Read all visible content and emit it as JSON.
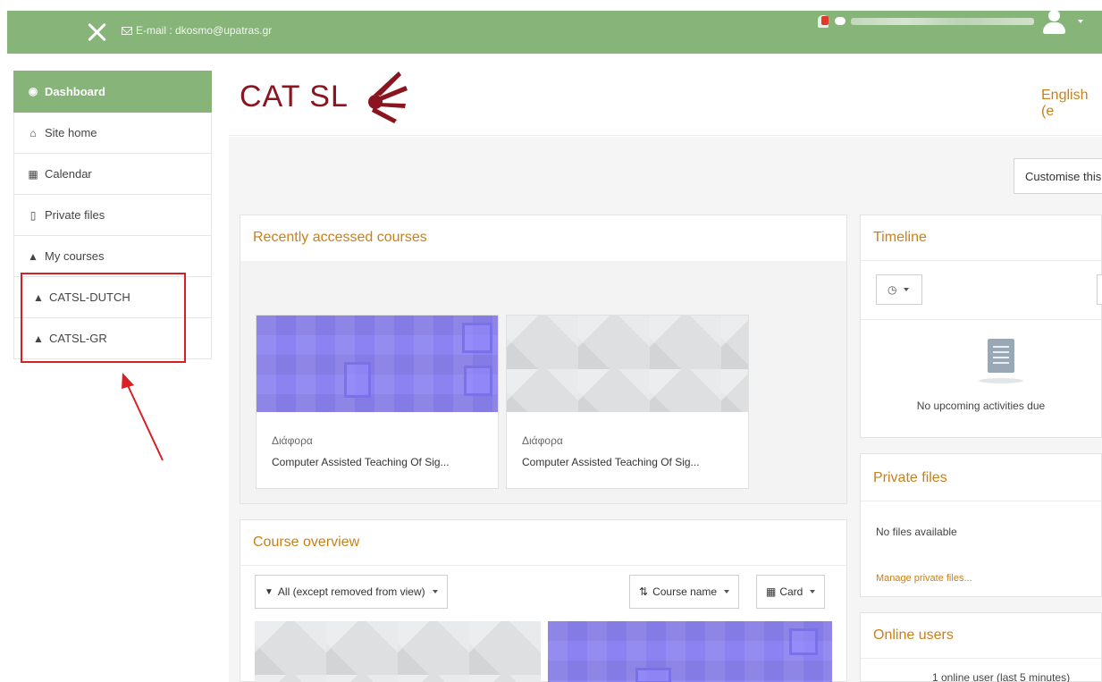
{
  "navbar": {
    "email_label": "E-mail : dkosmo@upatras.gr"
  },
  "sidebar": {
    "items": [
      {
        "label": "Dashboard",
        "icon": "dashboard-icon",
        "glyph": "✿"
      },
      {
        "label": "Site home",
        "icon": "home-icon",
        "glyph": "⌂"
      },
      {
        "label": "Calendar",
        "icon": "calendar-icon",
        "glyph": "▦"
      },
      {
        "label": "Private files",
        "icon": "file-icon",
        "glyph": "▢"
      },
      {
        "label": "My courses",
        "icon": "graduation-cap-icon",
        "glyph": "🎓"
      },
      {
        "label": "CATSL-DUTCH",
        "icon": "graduation-cap-icon",
        "glyph": "🎓"
      },
      {
        "label": "CATSL-GR",
        "icon": "graduation-cap-icon",
        "glyph": "🎓"
      }
    ]
  },
  "header": {
    "logo_text": "CAT SL",
    "language": "English (e",
    "customise_button": "Customise this"
  },
  "recent": {
    "title": "Recently accessed courses",
    "courses": [
      {
        "category": "Διάφορα",
        "name": "Computer Assisted Teaching Of Sig..."
      },
      {
        "category": "Διάφορα",
        "name": "Computer Assisted Teaching Of Sig..."
      }
    ]
  },
  "overview": {
    "title": "Course overview",
    "filter_label": "All (except removed from view)",
    "sort_label": "Course name",
    "view_label": "Card"
  },
  "timeline": {
    "title": "Timeline",
    "empty_text": "No upcoming activities due"
  },
  "private_files": {
    "title": "Private files",
    "empty_text": "No files available",
    "manage_link": "Manage private files..."
  },
  "online_users": {
    "title": "Online users",
    "status_text": "1 online user (last 5 minutes)"
  },
  "colors": {
    "brand_green": "#86b479",
    "accent_orange": "#c8811a",
    "highlight_red": "#d91f26"
  }
}
